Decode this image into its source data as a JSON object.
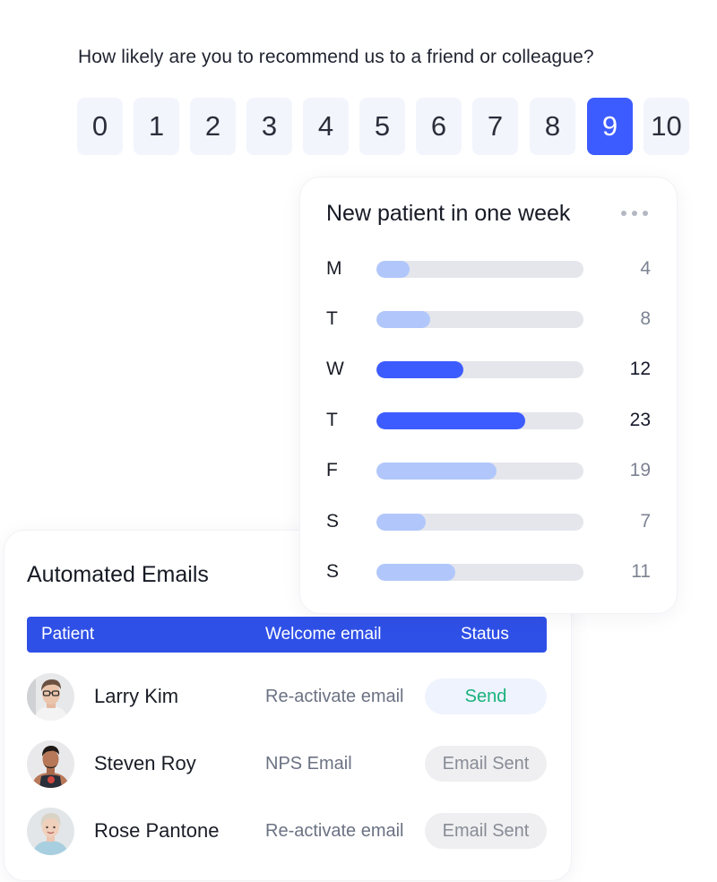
{
  "nps": {
    "question": "How likely are you to recommend us to a friend or colleague?",
    "options": [
      "0",
      "1",
      "2",
      "3",
      "4",
      "5",
      "6",
      "7",
      "8",
      "9",
      "10"
    ],
    "selected": "9",
    "accent_color": "#3d5cff"
  },
  "patients_card": {
    "title": "New patient in one week",
    "menu_icon": "more-horizontal-icon",
    "max_value": 31,
    "days": [
      {
        "label": "M",
        "value": "4",
        "fraction": 0.16,
        "highlight": false
      },
      {
        "label": "T",
        "value": "8",
        "fraction": 0.26,
        "highlight": false
      },
      {
        "label": "W",
        "value": "12",
        "fraction": 0.42,
        "highlight": true
      },
      {
        "label": "T",
        "value": "23",
        "fraction": 0.72,
        "highlight": true
      },
      {
        "label": "F",
        "value": "19",
        "fraction": 0.58,
        "highlight": false
      },
      {
        "label": "S",
        "value": "7",
        "fraction": 0.24,
        "highlight": false
      },
      {
        "label": "S",
        "value": "11",
        "fraction": 0.38,
        "highlight": false
      }
    ]
  },
  "emails_card": {
    "title": "Automated Emails",
    "headers": {
      "patient": "Patient",
      "welcome": "Welcome email",
      "status": "Status"
    },
    "rows": [
      {
        "name": "Larry Kim",
        "email": "Re-activate email",
        "status": "Send",
        "status_type": "send"
      },
      {
        "name": "Steven Roy",
        "email": "NPS Email",
        "status": "Email Sent",
        "status_type": "sent"
      },
      {
        "name": "Rose Pantone",
        "email": "Re-activate email",
        "status": "Email Sent",
        "status_type": "sent"
      }
    ]
  }
}
